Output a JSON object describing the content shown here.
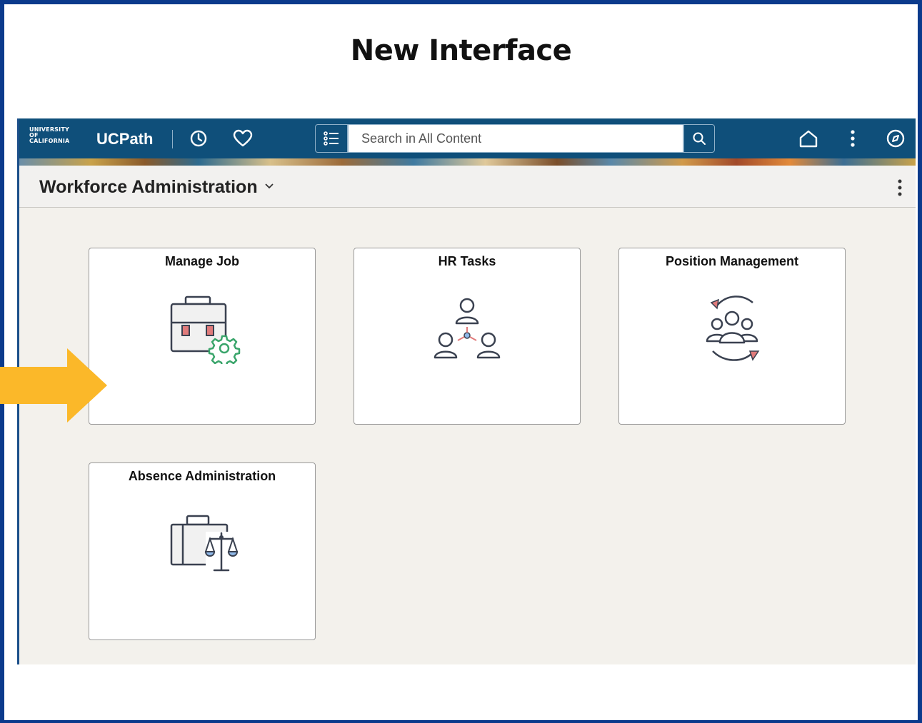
{
  "slide": {
    "title": "New Interface"
  },
  "topbar": {
    "logo_lines": [
      "UNIVERSITY",
      "OF",
      "CALIFORNIA"
    ],
    "app_name": "UCPath",
    "icons": [
      "history-icon",
      "favorites-heart-icon",
      "nav-list-icon",
      "search-icon",
      "home-icon",
      "actions-menu-icon",
      "navbar-compass-icon"
    ],
    "search": {
      "placeholder": "Search in All Content",
      "value": ""
    }
  },
  "subheader": {
    "title": "Workforce Administration",
    "chevron": "chevron-down-icon",
    "menu": "more-options-icon"
  },
  "tiles": [
    {
      "label": "Manage Job",
      "icon": "briefcase-gear-icon"
    },
    {
      "label": "HR Tasks",
      "icon": "people-network-icon"
    },
    {
      "label": "Position Management",
      "icon": "group-cycle-icon"
    },
    {
      "label": "Absence Administration",
      "icon": "briefcase-scales-icon"
    }
  ],
  "colors": {
    "frame": "#0b3a8c",
    "topbar": "#0f4f7a",
    "arrow": "#fbb829",
    "accent_red": "#e07b7b",
    "accent_green": "#3aa56b"
  }
}
